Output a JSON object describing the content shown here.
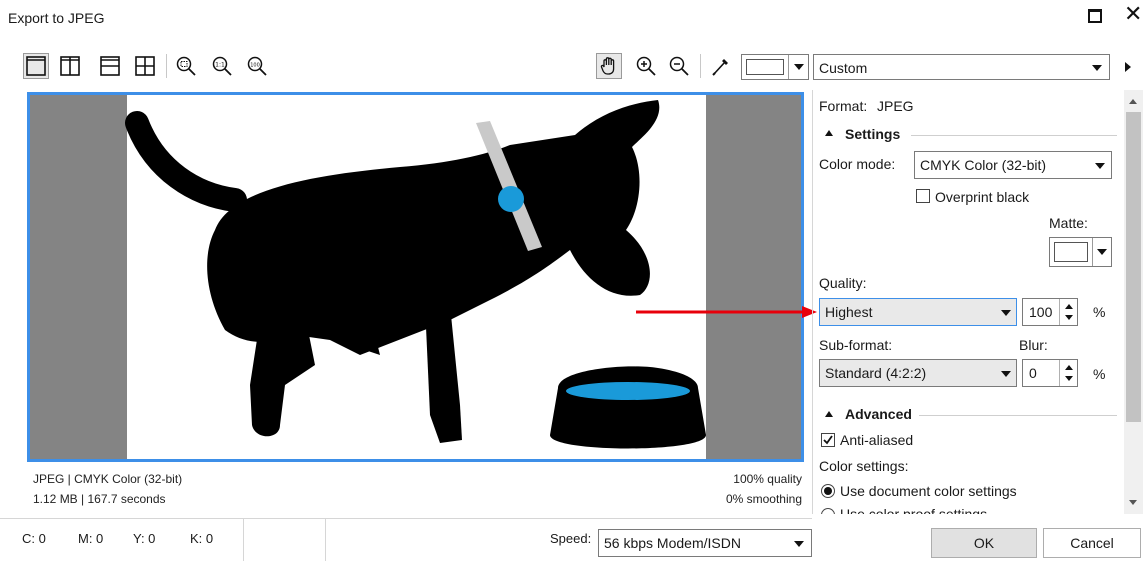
{
  "window": {
    "title": "Export to JPEG"
  },
  "toolbar": {
    "icons": [
      "single-view-icon",
      "side-by-side-view-icon",
      "stacked-view-icon",
      "quad-view-icon",
      "zoom-fit-icon",
      "zoom-actual-icon",
      "zoom-100-icon",
      "pan-hand-icon",
      "zoom-in-icon",
      "zoom-out-icon",
      "eyedropper-icon",
      "color-swatch-icon"
    ],
    "zoom_100_label": "100",
    "preset_value": "Custom"
  },
  "preview": {
    "format_line": "JPEG  |  CMYK Color (32-bit)",
    "size_line": "1.12 MB  |  167.7 seconds",
    "quality_line": "100% quality",
    "smoothing_line": "0% smoothing",
    "colors": {
      "frame": "#3d8fe8",
      "side_gray": "#848484",
      "accent_blue": "#1a9ad9",
      "collar": "#c9c9c9",
      "dog": "#000000"
    }
  },
  "statusbar": {
    "c": "C: 0",
    "m": "M: 0",
    "y": "Y: 0",
    "k": "K: 0",
    "speed_label": "Speed:",
    "speed_value": "56 kbps Modem/ISDN"
  },
  "panel": {
    "format_label": "Format:",
    "format_value": "JPEG",
    "settings_title": "Settings",
    "color_mode_label": "Color mode:",
    "color_mode_value": "CMYK Color (32-bit)",
    "overprint_label": "Overprint black",
    "overprint_checked": false,
    "matte_label": "Matte:",
    "quality_label": "Quality:",
    "quality_value": "Highest",
    "quality_number": "100",
    "quality_unit": "%",
    "subformat_label": "Sub-format:",
    "subformat_value": "Standard (4:2:2)",
    "blur_label": "Blur:",
    "blur_value": "0",
    "blur_unit": "%",
    "advanced_title": "Advanced",
    "antialiased_label": "Anti-aliased",
    "antialiased_checked": true,
    "color_settings_label": "Color settings:",
    "use_document_label": "Use document color settings",
    "use_proof_label": "Use color proof settings"
  },
  "buttons": {
    "ok": "OK",
    "cancel": "Cancel"
  },
  "annotation": {
    "arrow_color": "#e8000b"
  }
}
